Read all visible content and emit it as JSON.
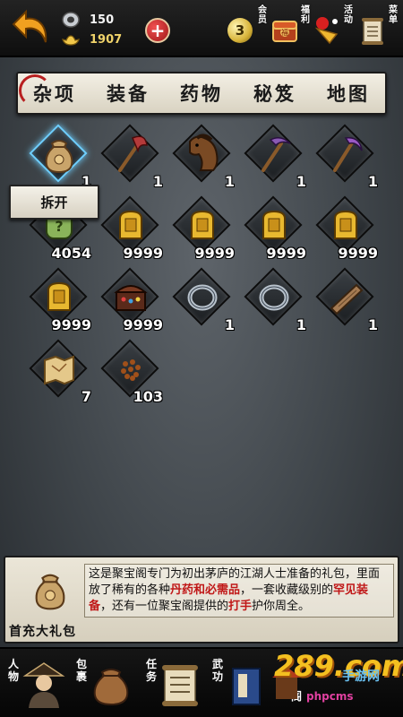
{
  "currency": {
    "silver": "150",
    "gold": "1907"
  },
  "add_label": "+",
  "top_icons": [
    {
      "label": "会员",
      "badge": "3",
      "icon": "vip-coin-icon"
    },
    {
      "label": "福利",
      "icon": "gift-chest-icon"
    },
    {
      "label": "活动",
      "icon": "activity-icon"
    },
    {
      "label": "菜单",
      "icon": "menu-scroll-icon"
    }
  ],
  "tabs": [
    "杂项",
    "装备",
    "药物",
    "秘笈",
    "地图"
  ],
  "active_tab": 0,
  "items": [
    {
      "icon": "pouch-icon",
      "count": "1",
      "selected": true
    },
    {
      "icon": "axe-icon",
      "count": "1"
    },
    {
      "icon": "horse-icon",
      "count": "1"
    },
    {
      "icon": "pickaxe-icon",
      "count": "1"
    },
    {
      "icon": "scythe-icon",
      "count": "1"
    },
    {
      "icon": "mystery-stone-icon",
      "count": "4054"
    },
    {
      "icon": "gold-tablet-icon",
      "count": "9999"
    },
    {
      "icon": "gold-tablet-icon",
      "count": "9999"
    },
    {
      "icon": "gold-tablet-icon",
      "count": "9999"
    },
    {
      "icon": "gold-tablet-icon",
      "count": "9999"
    },
    {
      "icon": "gold-tablet-icon",
      "count": "9999"
    },
    {
      "icon": "treasure-chest-icon",
      "count": "9999"
    },
    {
      "icon": "iron-ring-icon",
      "count": "1"
    },
    {
      "icon": "iron-ring-icon",
      "count": "1"
    },
    {
      "icon": "wood-plank-icon",
      "count": "1"
    },
    {
      "icon": "map-scroll-icon",
      "count": "7"
    },
    {
      "icon": "seeds-icon",
      "count": "103"
    }
  ],
  "split_label": "拆开",
  "description": {
    "name": "首充大礼包",
    "text_parts": [
      {
        "t": "这是聚宝阁专门为初出茅庐的江湖人士准备的礼包，里面放了稀有的各种",
        "hl": false
      },
      {
        "t": "丹药和必需品",
        "hl": true
      },
      {
        "t": "，一套收藏级别的",
        "hl": false
      },
      {
        "t": "罕见装备",
        "hl": true
      },
      {
        "t": "，还有一位聚宝阁提供的",
        "hl": false
      },
      {
        "t": "打手",
        "hl": true
      },
      {
        "t": "护你周全。",
        "hl": false
      }
    ]
  },
  "bottom_nav": [
    {
      "label": "人物",
      "icon": "character-icon"
    },
    {
      "label": "包裹",
      "icon": "bag-icon"
    },
    {
      "label": "任务",
      "icon": "quest-scroll-icon"
    },
    {
      "label": "武功",
      "icon": "martial-book-icon"
    },
    {
      "label": "阁",
      "icon": "pavilion-icon"
    }
  ],
  "watermark": {
    "big": "289.com",
    "sub": "手游网",
    "small": "phpcms"
  },
  "colors": {
    "highlight": "#c01818",
    "gold": "#f0d36a",
    "selected": "#6fd0ff",
    "panel": "#e4dfd0"
  }
}
